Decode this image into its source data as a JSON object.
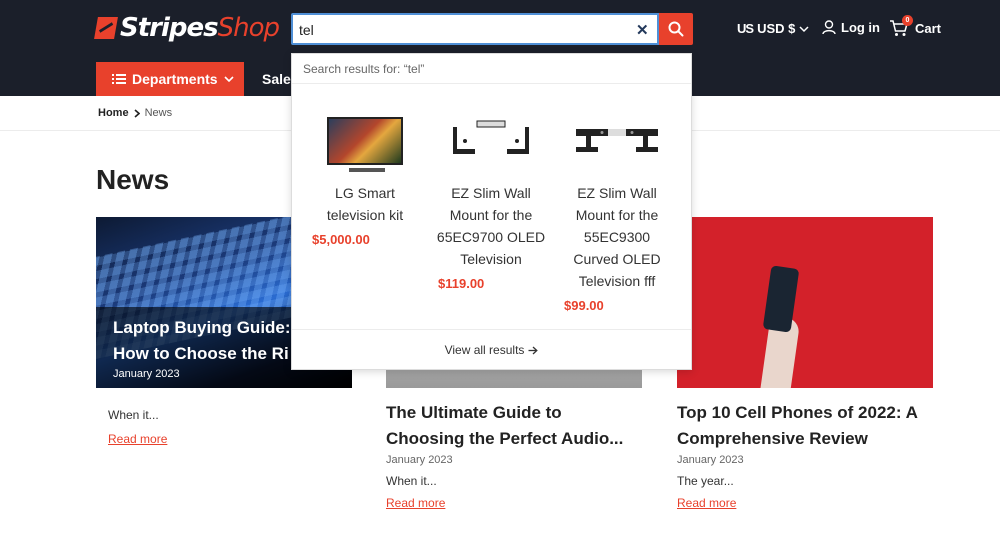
{
  "header": {
    "logo_part1": "Stripes",
    "logo_part2": "Shop",
    "currency_flag": "US",
    "currency_label": "USD $",
    "login_label": "Log in",
    "cart_label": "Cart",
    "cart_count": "0"
  },
  "search": {
    "value": "tel",
    "results_header": "Search results for: “tel”",
    "view_all": "View all results",
    "results": [
      {
        "name_lines": [
          "LG Smart",
          "television kit"
        ],
        "price": "$5,000.00"
      },
      {
        "name_lines": [
          "EZ Slim Wall",
          "Mount for the",
          "65EC9700 OLED",
          "Television"
        ],
        "price": "$119.00"
      },
      {
        "name_lines": [
          "EZ Slim Wall",
          "Mount for the",
          "55EC9300",
          "Curved OLED",
          "Television fff"
        ],
        "price": "$99.00"
      }
    ]
  },
  "nav": {
    "departments_label": "Departments",
    "sale_label": "Sale"
  },
  "breadcrumb": {
    "home": "Home",
    "current": "News"
  },
  "page": {
    "title": "News"
  },
  "articles": [
    {
      "title_line1": "Laptop Buying Guide:",
      "title_line2": "How to Choose the Ri",
      "date": "January 2023",
      "excerpt": "When it...",
      "link": "Read more"
    },
    {
      "title_line1": "The Ultimate Guide to",
      "title_line2": "Choosing the Perfect Audio...",
      "date": "January 2023",
      "excerpt": "When it...",
      "link": "Read more"
    },
    {
      "title_line1": "Top 10 Cell Phones of 2022: A",
      "title_line2": "Comprehensive Review",
      "date": "January 2023",
      "excerpt": "The year...",
      "link": "Read more"
    }
  ],
  "colors": {
    "accent": "#e8412c",
    "header_bg": "#1b1f2a"
  }
}
